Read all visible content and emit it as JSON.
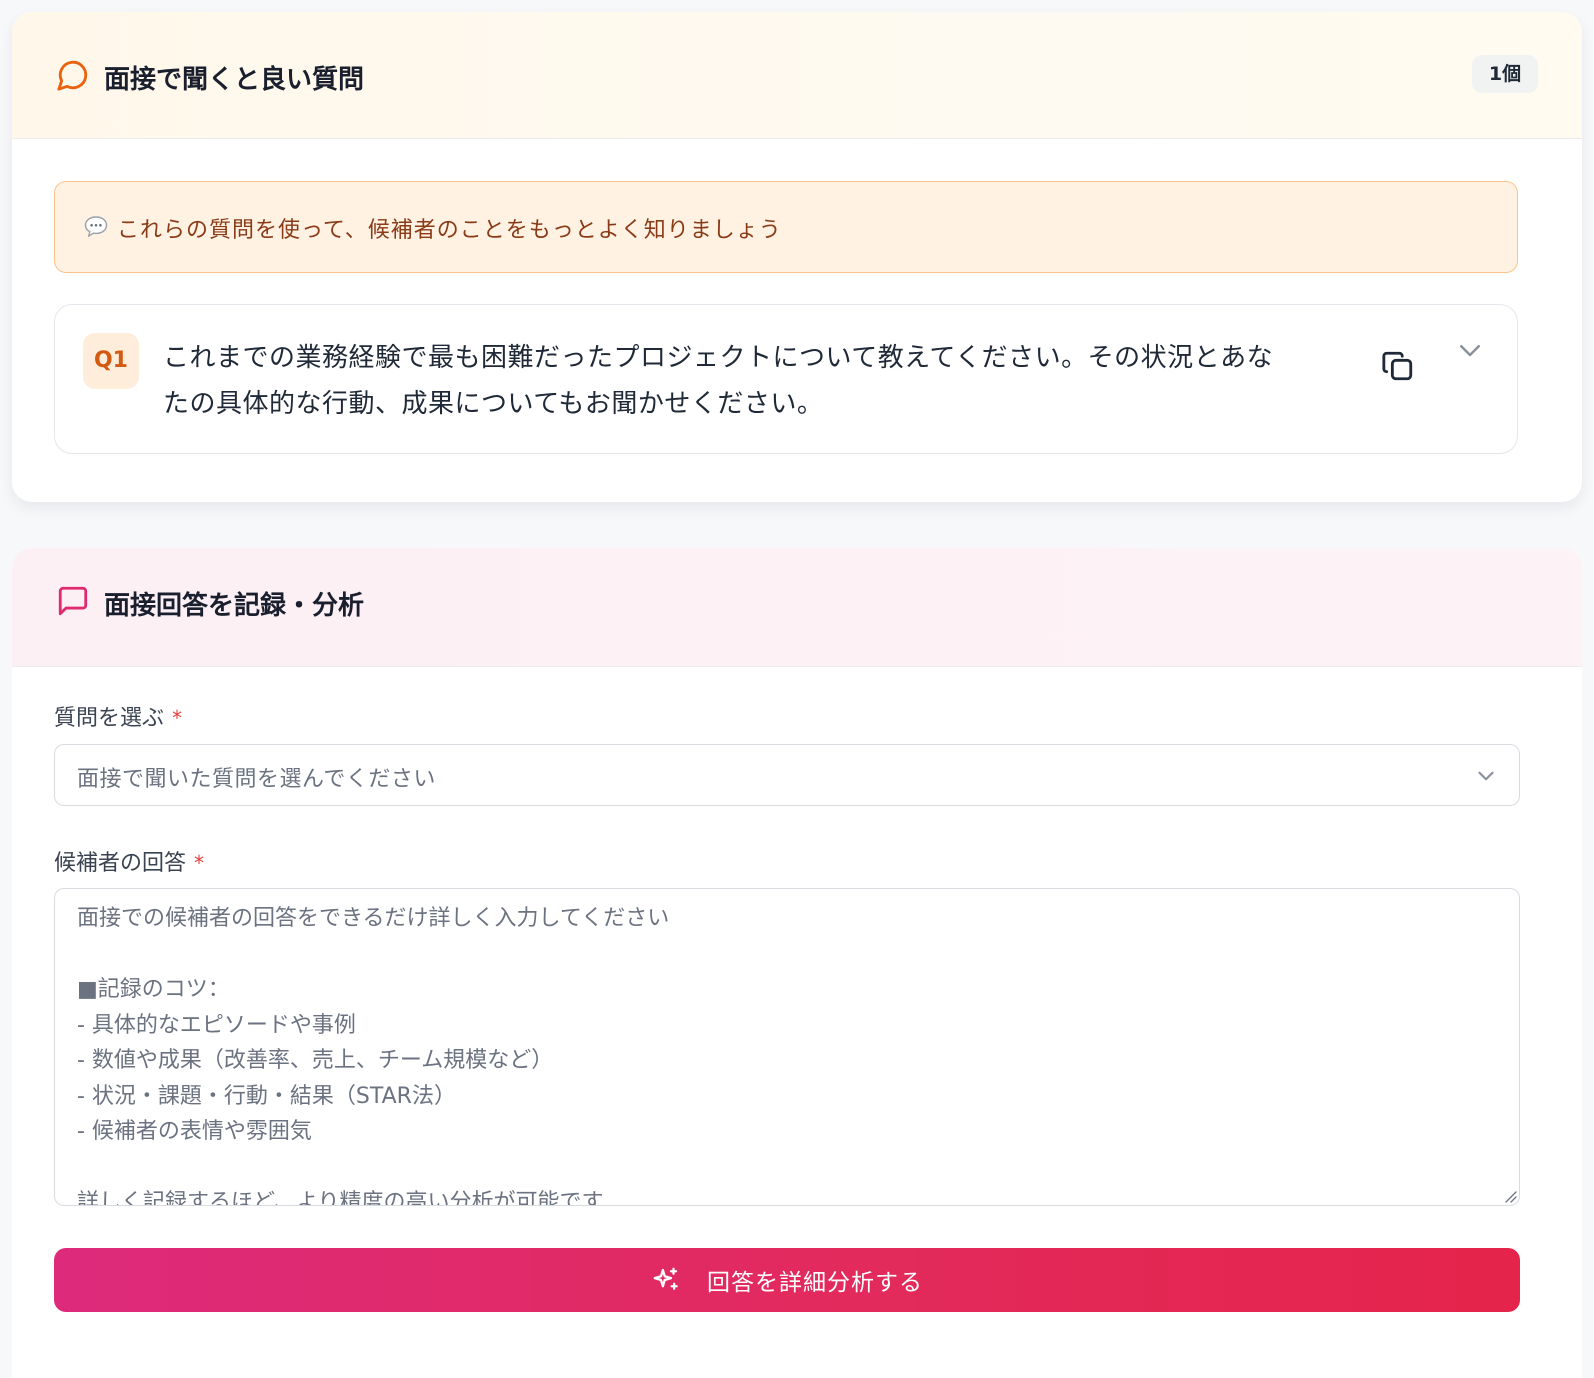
{
  "questions_card": {
    "title": "面接で聞くと良い質問",
    "header_icon": "message-circle-icon",
    "count_badge": "1個",
    "tip": {
      "icon": "speech-bubble-icon",
      "text": "これらの質問を使って、候補者のことをもっとよく知りましょう"
    },
    "items": [
      {
        "badge": "Q1",
        "line1": "これまでの業務経験で最も困難だったプロジェクトについて教えてください。その状況とあな",
        "line2": "たの具体的な行動、成果についてもお聞かせください。",
        "copy_icon": "copy-icon",
        "expand_icon": "chevron-down-icon"
      }
    ]
  },
  "record_card": {
    "title": "面接回答を記録・分析",
    "header_icon": "message-square-icon",
    "question_field": {
      "label": "質問を選ぶ",
      "required_mark": "*",
      "placeholder": "面接で聞いた質問を選んでください",
      "icon": "chevron-down-icon"
    },
    "answer_field": {
      "label": "候補者の回答",
      "required_mark": "*",
      "placeholder": "面接での候補者の回答をできるだけ詳しく入力してください\n\n■記録のコツ：\n- 具体的なエピソードや事例\n- 数値や成果（改善率、売上、チーム規模など）\n- 状況・課題・行動・結果（STAR法）\n- 候補者の表情や雰囲気\n\n詳しく記録するほど、より精度の高い分析が可能です"
    },
    "submit": {
      "icon": "sparkles-icon",
      "label": "回答を詳細分析する"
    }
  },
  "colors": {
    "accent_orange": "#e8620f",
    "accent_pink": "#de2a6f",
    "button_gradient_start": "#dd2a7b",
    "button_gradient_end": "#e5244b",
    "required": "#e53e3e"
  }
}
